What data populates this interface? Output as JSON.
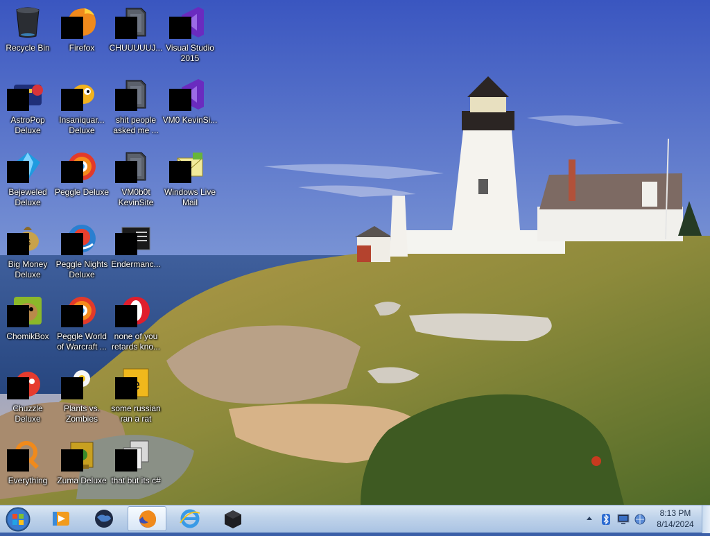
{
  "desktop": {
    "icons": [
      {
        "label": "Recycle Bin",
        "icon": "recycle-bin-icon"
      },
      {
        "label": "Firefox",
        "icon": "firefox-icon"
      },
      {
        "label": "CHUUUUUJ...",
        "icon": "folder-icon"
      },
      {
        "label": "Visual Studio 2015",
        "icon": "visual-studio-icon"
      },
      {
        "label": "AstroPop Deluxe",
        "icon": "astropop-icon"
      },
      {
        "label": "Insaniquar... Deluxe",
        "icon": "insaniquarium-icon"
      },
      {
        "label": "shit people asked me ...",
        "icon": "folder-icon"
      },
      {
        "label": "VM0 KevinSi...",
        "icon": "visual-studio-icon"
      },
      {
        "label": "Bejeweled Deluxe",
        "icon": "bejeweled-icon"
      },
      {
        "label": "Peggle Deluxe",
        "icon": "peggle-icon"
      },
      {
        "label": "VM0b0t KevinSite",
        "icon": "folder-icon"
      },
      {
        "label": "Windows Live Mail",
        "icon": "mail-icon"
      },
      {
        "label": "Big Money Deluxe",
        "icon": "big-money-icon"
      },
      {
        "label": "Peggle Nights Deluxe",
        "icon": "peggle-nights-icon"
      },
      {
        "label": "Endermanc...",
        "icon": "terminal-icon"
      },
      {
        "label": "ChomikBox",
        "icon": "chomikbox-icon"
      },
      {
        "label": "Peggle World of Warcraft ...",
        "icon": "peggle-icon"
      },
      {
        "label": "none of you retards kno...",
        "icon": "opera-icon"
      },
      {
        "label": "Chuzzle Deluxe",
        "icon": "chuzzle-icon"
      },
      {
        "label": "Plants vs. Zombies",
        "icon": "plants-vs-zombies-icon"
      },
      {
        "label": "some russian ran a rat",
        "icon": "document-icon"
      },
      {
        "label": "Everything",
        "icon": "search-icon"
      },
      {
        "label": "Zuma Deluxe",
        "icon": "zuma-icon"
      },
      {
        "label": "that but its c#",
        "icon": "copy-icon"
      }
    ]
  },
  "taskbar": {
    "start": {
      "icon": "windows-start-icon"
    },
    "pinned": [
      {
        "icon": "media-player-icon",
        "name": "Windows Media Player",
        "active": false
      },
      {
        "icon": "globe-icon",
        "name": "Browser",
        "active": false
      },
      {
        "icon": "firefox-icon",
        "name": "Firefox",
        "active": true
      },
      {
        "icon": "internet-explorer-icon",
        "name": "Internet Explorer",
        "active": false
      },
      {
        "icon": "box-icon",
        "name": "Program",
        "active": false
      }
    ],
    "tray": {
      "icons": [
        "show-hidden-icons-chevron",
        "bluetooth-icon",
        "monitor-icon",
        "network-icon"
      ],
      "time": "8:13 PM",
      "date": "8/14/2024"
    }
  },
  "colors": {
    "sky_top": "#3b5fc4",
    "sky_bottom": "#9cb4e0",
    "sea": "#2c4f8c",
    "grass": "#9a8a3a",
    "taskbar": "#bfd3ea"
  }
}
